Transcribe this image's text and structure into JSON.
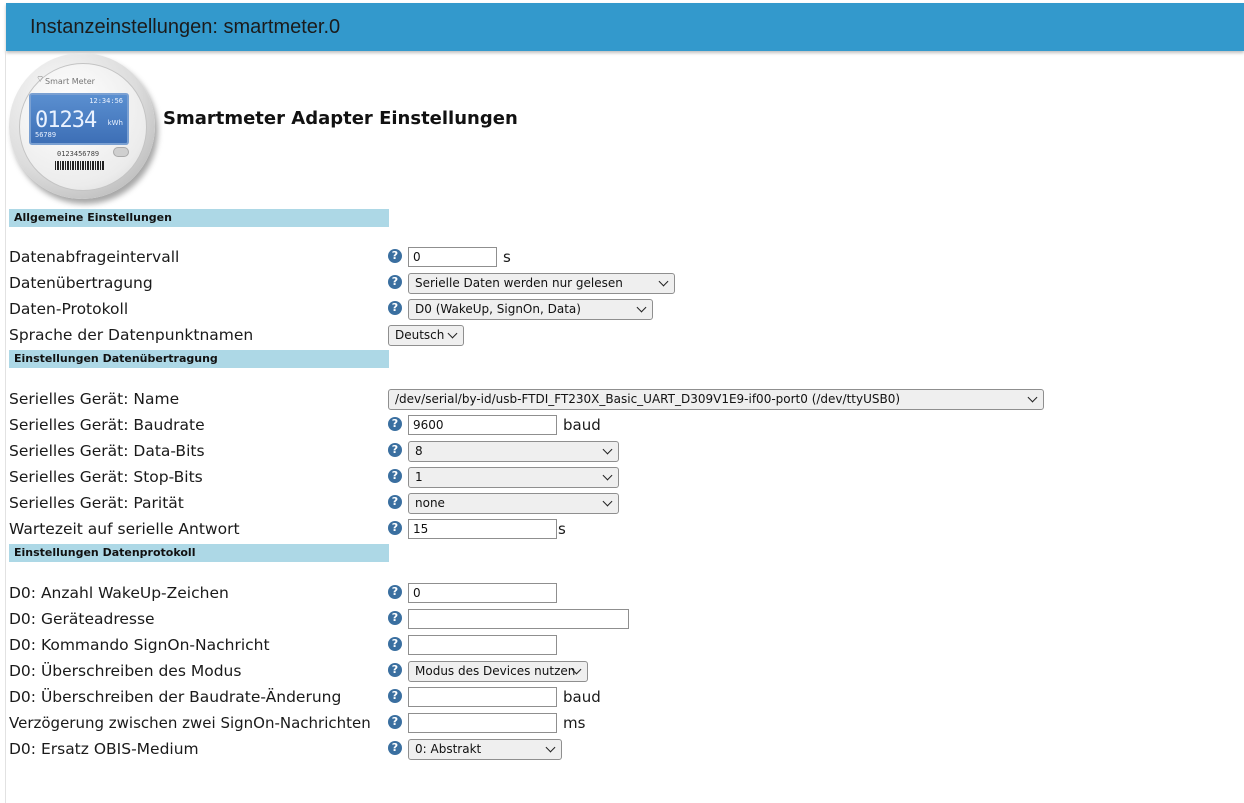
{
  "window": {
    "title": "Instanzeinstellungen: smartmeter.0"
  },
  "logo": {
    "brand": "Smart Meter",
    "time": "12:34:56",
    "reading": "01234",
    "unit": "kWh",
    "sub": "56789",
    "serial": "0123456789"
  },
  "heading": "Smartmeter Adapter Einstellungen",
  "sections": {
    "general": "Allgemeine Einstellungen",
    "transfer": "Einstellungen Datenübertragung",
    "protocol": "Einstellungen Datenprotokoll"
  },
  "help_glyph": "?",
  "fields": {
    "interval": {
      "label": "Datenabfrageintervall",
      "value": "0",
      "unit": "s"
    },
    "transfer": {
      "label": "Datenübertragung",
      "value": "Serielle Daten werden nur gelesen"
    },
    "protocol": {
      "label": "Daten-Protokoll",
      "value": "D0 (WakeUp, SignOn, Data)"
    },
    "language": {
      "label": "Sprache der Datenpunktnamen",
      "value": "Deutsch"
    },
    "serial_name": {
      "label": "Serielles Gerät: Name",
      "value": "/dev/serial/by-id/usb-FTDI_FT230X_Basic_UART_D309V1E9-if00-port0 (/dev/ttyUSB0)"
    },
    "baudrate": {
      "label": "Serielles Gerät: Baudrate",
      "value": "9600",
      "unit": "baud"
    },
    "databits": {
      "label": "Serielles Gerät: Data-Bits",
      "value": "8"
    },
    "stopbits": {
      "label": "Serielles Gerät: Stop-Bits",
      "value": "1"
    },
    "parity": {
      "label": "Serielles Gerät: Parität",
      "value": "none"
    },
    "wait": {
      "label": "Wartezeit auf serielle Antwort",
      "value": "15",
      "unit": "s"
    },
    "wakeup": {
      "label": "D0: Anzahl WakeUp-Zeichen",
      "value": "0"
    },
    "address": {
      "label": "D0: Geräteadresse",
      "value": ""
    },
    "signon": {
      "label": "D0: Kommando SignOn-Nachricht",
      "value": ""
    },
    "mode": {
      "label": "D0: Überschreiben des Modus",
      "value": "Modus des Devices nutzen"
    },
    "baudchange": {
      "label": "D0: Überschreiben der Baudrate-Änderung",
      "value": "",
      "unit": "baud"
    },
    "delay": {
      "label": "Verzögerung zwischen zwei SignOn-Nachrichten",
      "value": "",
      "unit": "ms"
    },
    "obis": {
      "label": "D0: Ersatz OBIS-Medium",
      "value": "0: Abstrakt"
    }
  }
}
